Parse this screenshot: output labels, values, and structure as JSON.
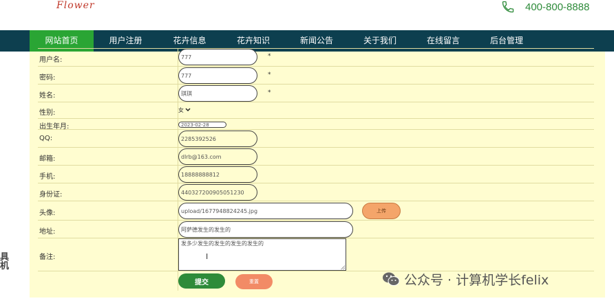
{
  "header": {
    "logo_text": "Flower",
    "phone": "400-800-8888",
    "phone_icon": "phone-icon"
  },
  "nav": {
    "items": [
      {
        "label": "网站首页",
        "active": true
      },
      {
        "label": "用户注册"
      },
      {
        "label": "花卉信息"
      },
      {
        "label": "花卉知识"
      },
      {
        "label": "新闻公告"
      },
      {
        "label": "关于我们"
      },
      {
        "label": "在线留言"
      },
      {
        "label": "后台管理"
      }
    ]
  },
  "form": {
    "username": {
      "label": "用户名:",
      "value": "777",
      "required": "*"
    },
    "password": {
      "label": "密码:",
      "value": "777",
      "required": "*"
    },
    "name": {
      "label": "姓名:",
      "value": "琪琪",
      "required": "*"
    },
    "gender": {
      "label": "性别:",
      "value": "女"
    },
    "birthday": {
      "label": "出生年月:",
      "value": "2023-02-28"
    },
    "qq": {
      "label": "QQ:",
      "value": "2285392526"
    },
    "email": {
      "label": "邮箱:",
      "value": "dlrb@163.com"
    },
    "mobile": {
      "label": "手机:",
      "value": "18888888812"
    },
    "idcard": {
      "label": "身份证:",
      "value": "440327200905051230"
    },
    "avatar": {
      "label": "头像:",
      "value": "upload/1677948824245.jpg",
      "upload_label": "上传"
    },
    "address": {
      "label": "地址:",
      "value": "阿萨德发生的发生的"
    },
    "remark": {
      "label": "备注:",
      "value": "发多少发生的发生的发生的发生的"
    },
    "submit_label": "提交",
    "reset_label": "重置"
  },
  "side_text": "具\n机",
  "watermark": {
    "text": "公众号 · 计算机学长felix",
    "icon": "wechat-icon"
  },
  "colors": {
    "nav_bg": "#0d3f4f",
    "nav_active": "#2aa534",
    "panel_bg": "#fffdd0",
    "submit": "#2e8b3a",
    "reset": "#f28b66",
    "upload": "#f4a56a",
    "phone_text": "#2e8b3a"
  }
}
